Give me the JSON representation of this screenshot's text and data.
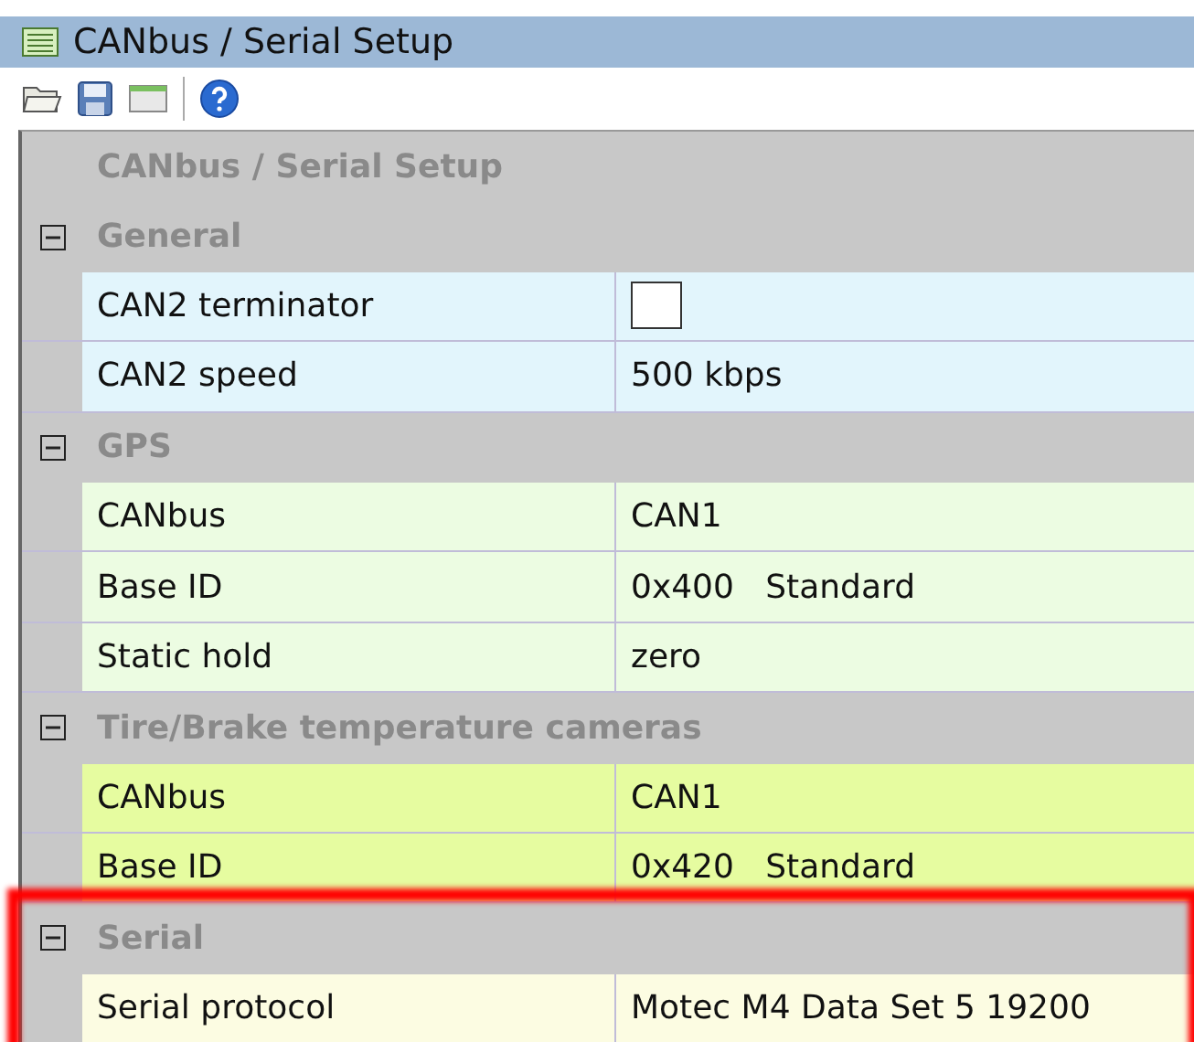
{
  "window": {
    "title": "CANbus / Serial Setup"
  },
  "toolbar": [
    {
      "kind": "open"
    },
    {
      "kind": "save"
    },
    {
      "kind": "window"
    },
    {
      "kind": "help"
    }
  ],
  "grid": {
    "title": "CANbus / Serial Setup",
    "groups": [
      {
        "name": "General",
        "expanded": true,
        "color": "#e2f5fc",
        "highlighted": false,
        "rows": [
          {
            "label": "CAN2 terminator",
            "kind": "checkbox",
            "checked": false
          },
          {
            "label": "CAN2 speed",
            "kind": "text",
            "value": "500 kbps"
          }
        ]
      },
      {
        "name": "GPS",
        "expanded": true,
        "color": "#ecfce2",
        "highlighted": false,
        "rows": [
          {
            "label": "CANbus",
            "kind": "text",
            "value": "CAN1"
          },
          {
            "label": "Base ID",
            "kind": "text",
            "value": "0x400   Standard"
          },
          {
            "label": "Static hold",
            "kind": "text",
            "value": "zero"
          }
        ]
      },
      {
        "name": "Tire/Brake temperature cameras",
        "expanded": true,
        "color": "#e6fca0",
        "highlighted": false,
        "rows": [
          {
            "label": "CANbus",
            "kind": "text",
            "value": "CAN1"
          },
          {
            "label": "Base ID",
            "kind": "text",
            "value": "0x420   Standard"
          }
        ]
      },
      {
        "name": "Serial",
        "expanded": true,
        "color": "#fcfce2",
        "highlighted": true,
        "rows": [
          {
            "label": "Serial protocol",
            "kind": "text",
            "value": "Motec M4 Data Set 5 19200"
          }
        ]
      }
    ]
  }
}
